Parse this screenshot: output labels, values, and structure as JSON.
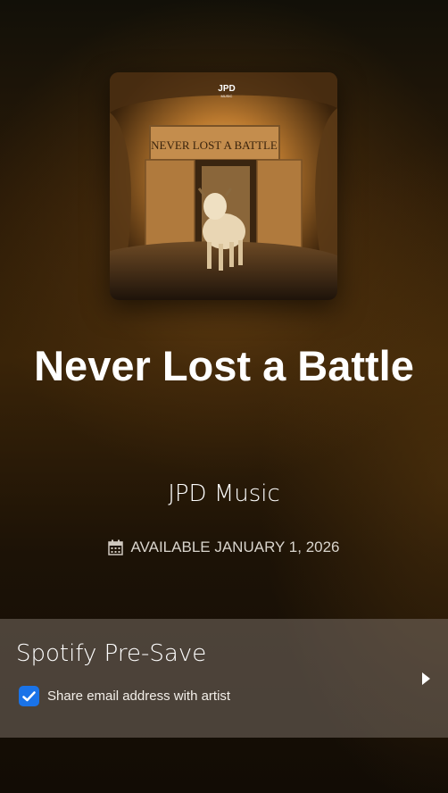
{
  "release": {
    "artwork": {
      "logo_text": "JPD",
      "logo_subtext": "MUSIC",
      "stone_inscription": "NEVER LOST A BATTLE"
    },
    "title": "Never Lost a Battle",
    "artist": "JPD Music",
    "availability": "AVAILABLE JANUARY 1, 2026"
  },
  "presave": {
    "label": "Spotify Pre-Save",
    "share_email_label": "Share email address with artist",
    "share_email_checked": true,
    "accent_color": "#1a73e8"
  },
  "icons": {
    "calendar": "calendar-icon",
    "checkmark": "checkmark-icon",
    "arrow": "play-arrow-icon"
  }
}
